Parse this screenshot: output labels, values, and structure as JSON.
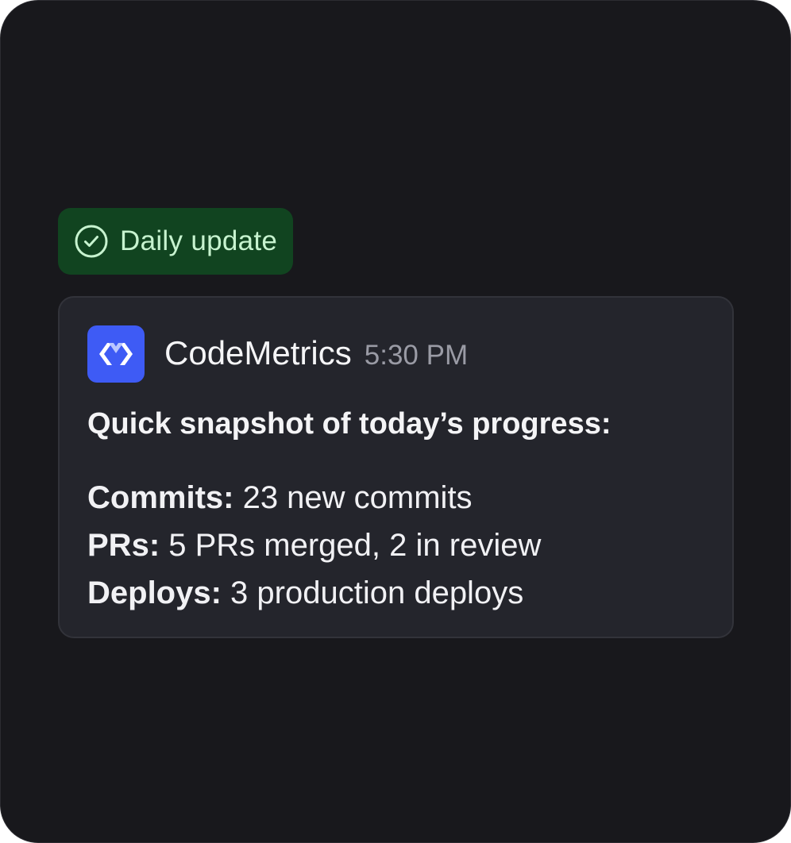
{
  "badge": {
    "label": "Daily update",
    "icon": "check-circle-icon",
    "background": "#114420",
    "text_color": "#c7f3cf"
  },
  "message": {
    "sender": "CodeMetrics",
    "time": "5:30 PM",
    "avatar_icon": "codemetrics-logo-icon",
    "avatar_color": "#3e5bf5",
    "headline": "Quick snapshot of today’s progress:",
    "stats": [
      {
        "label": "Commits:",
        "value": " 23 new commits"
      },
      {
        "label": "PRs:",
        "value": " 5 PRs merged, 2 in review"
      },
      {
        "label": "Deploys:",
        "value": " 3 production deploys"
      }
    ]
  }
}
